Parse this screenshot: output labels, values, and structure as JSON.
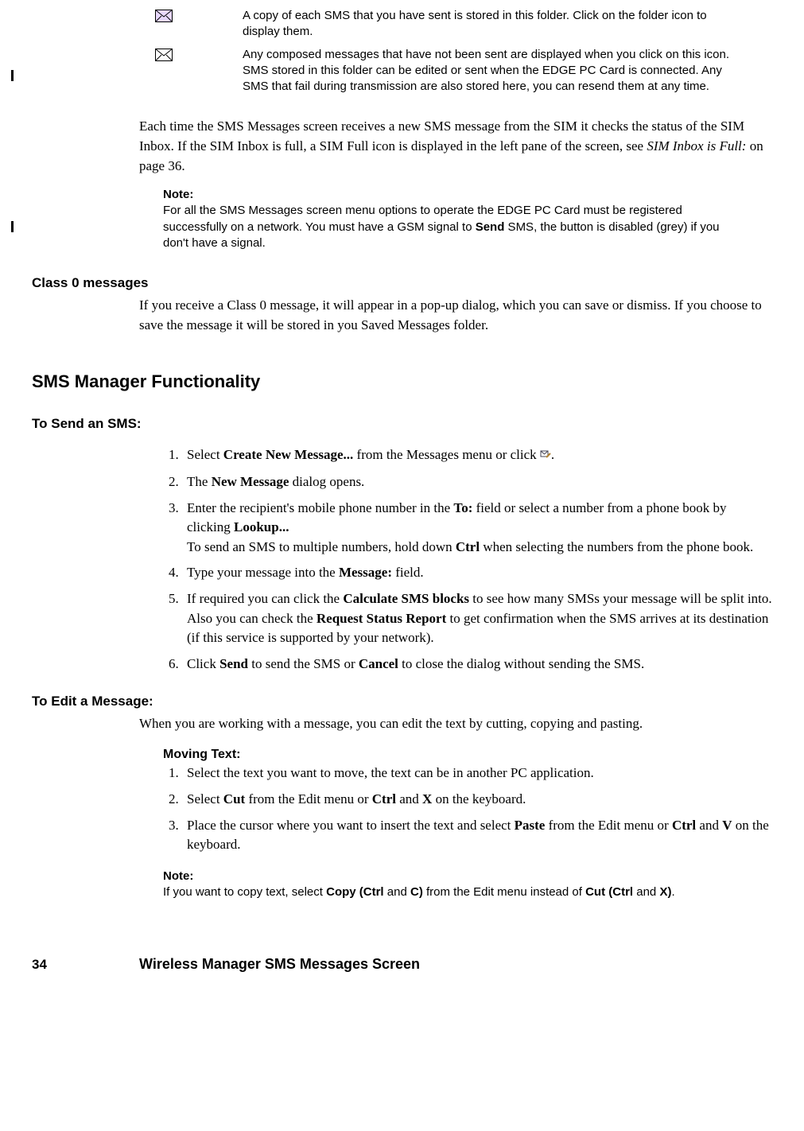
{
  "icons": {
    "sent_desc": "A copy of each SMS that you have sent is stored in this folder. Click on the folder icon to display them.",
    "unsent_desc_1": "Any composed messages that have not been sent are displayed when you click on this icon.",
    "unsent_desc_2": "SMS stored in this folder can be edited or sent when the EDGE PC Card is connected. Any SMS that fail during transmission are also stored here, you can resend them at any time."
  },
  "sim_paragraph": {
    "t1": "Each time the SMS Messages screen receives a new SMS message from the SIM it checks the status of the SIM Inbox. If the SIM Inbox is full, a SIM Full icon is displayed in the left pane of the screen, see ",
    "t2_ital": "SIM Inbox is Full:",
    "t3": " on page 36."
  },
  "note1": {
    "heading": "Note:",
    "t1": "For all the SMS Messages screen menu options to operate the EDGE PC Card must be registered successfully on a network. You must have a GSM signal to ",
    "b1": "Send",
    "t2": " SMS, the button is disabled (grey) if you don't have a signal."
  },
  "class0": {
    "heading": "Class 0 messages",
    "body": "If you receive a Class 0 message, it will appear in a pop-up dialog, which you can save or dismiss. If you choose to save the message it will be stored in you Saved Messages folder."
  },
  "section_heading": "SMS Manager Functionality",
  "to_send": {
    "heading": "To Send an SMS:",
    "s1_a": "Select ",
    "s1_b": "Create New Message...",
    "s1_c": " from the Messages menu or click ",
    "s1_d": ".",
    "s2_a": "The ",
    "s2_b": "New Message",
    "s2_c": " dialog opens.",
    "s3_a": "Enter the recipient's mobile phone number in the ",
    "s3_b": "To:",
    "s3_c": " field or select a number from a phone book by clicking ",
    "s3_d": "Lookup...",
    "s3_e": "To send an SMS to multiple numbers, hold down ",
    "s3_f": "Ctrl",
    "s3_g": " when selecting the numbers from the phone book.",
    "s4_a": "Type your message into the ",
    "s4_b": "Message:",
    "s4_c": " field.",
    "s5_a": "If required you can click the ",
    "s5_b": "Calculate SMS blocks",
    "s5_c": " to see how many SMSs your message will be split into. Also you can check the ",
    "s5_d": "Request Status Report",
    "s5_e": " to get confirmation when the SMS arrives at its destination (if this service is supported by your network).",
    "s6_a": "Click ",
    "s6_b": "Send",
    "s6_c": " to send the SMS or ",
    "s6_d": "Cancel",
    "s6_e": " to close the dialog without sending the SMS."
  },
  "to_edit": {
    "heading": "To Edit a Message:",
    "body": "When you are working with a message, you can edit the text by cutting, copying and pasting."
  },
  "moving": {
    "heading": "Moving Text:",
    "s1": "Select the text you want to move, the text can be in another PC application.",
    "s2_a": "Select ",
    "s2_b": "Cut",
    "s2_c": " from the Edit menu or ",
    "s2_d": "Ctrl",
    "s2_e": " and ",
    "s2_f": "X",
    "s2_g": " on the keyboard.",
    "s3_a": "Place the cursor where you want to insert the text and select ",
    "s3_b": "Paste",
    "s3_c": " from the Edit menu or ",
    "s3_d": "Ctrl",
    "s3_e": " and ",
    "s3_f": "V",
    "s3_g": " on the keyboard."
  },
  "note2": {
    "heading": "Note:",
    "t1": "If you want to copy text, select ",
    "b1": "Copy (Ctrl ",
    "t2": "and ",
    "b2": "C)",
    "t3": " from the Edit menu instead of ",
    "b3": "Cut (Ctrl ",
    "t4": "and ",
    "b4": "X)",
    "t5": "."
  },
  "footer": {
    "page": "34",
    "title": "Wireless Manager SMS Messages Screen"
  }
}
